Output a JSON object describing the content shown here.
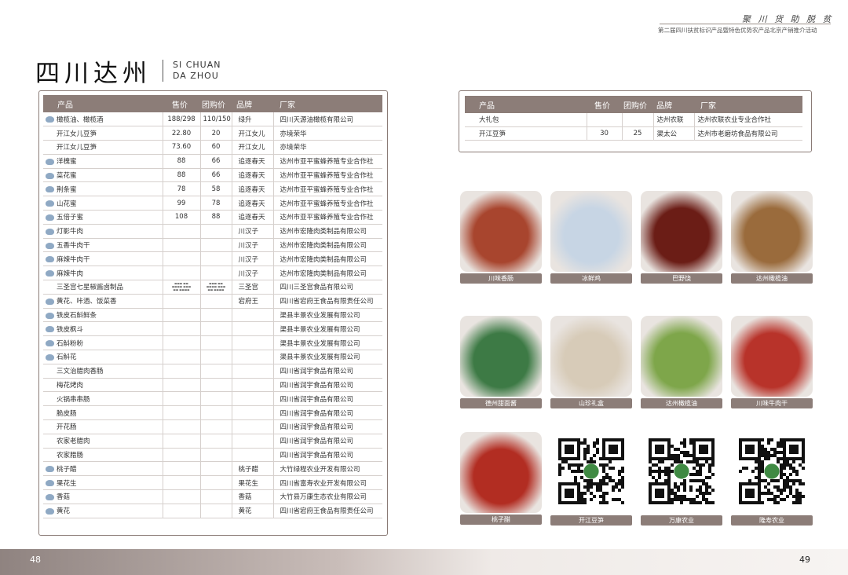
{
  "header": {
    "slogan": "聚 川 货   助 脱 贫",
    "subtitle": "第二届四川扶贫标识产品暨特色优势农产品北京产销推介活动"
  },
  "title": {
    "cn": "四川达州",
    "en1": "SI CHUAN",
    "en2": "DA ZHOU"
  },
  "left_table": {
    "headers": [
      "产品",
      "售价",
      "团购价",
      "品牌",
      "厂家"
    ],
    "rows": [
      {
        "icon": true,
        "product": "橄榄油、橄榄酒",
        "price": "188/298",
        "group": "110/150",
        "brand": "绿升",
        "maker": "四川天源油橄榄有限公司"
      },
      {
        "icon": false,
        "product": "开江女儿豆笋",
        "price": "22.80",
        "group": "20",
        "brand": "开江女儿",
        "maker": "亦境荣华"
      },
      {
        "icon": false,
        "product": "开江女儿豆笋",
        "price": "73.60",
        "group": "60",
        "brand": "开江女儿",
        "maker": "亦境荣华"
      },
      {
        "icon": true,
        "product": "洋槐蜜",
        "price": "88",
        "group": "66",
        "brand": "追逐春天",
        "maker": "达州市亚平蜜蜂养殖专业合作社"
      },
      {
        "icon": true,
        "product": "菜花蜜",
        "price": "88",
        "group": "66",
        "brand": "追逐春天",
        "maker": "达州市亚平蜜蜂养殖专业合作社"
      },
      {
        "icon": true,
        "product": "荆条蜜",
        "price": "78",
        "group": "58",
        "brand": "追逐春天",
        "maker": "达州市亚平蜜蜂养殖专业合作社"
      },
      {
        "icon": true,
        "product": "山花蜜",
        "price": "99",
        "group": "78",
        "brand": "追逐春天",
        "maker": "达州市亚平蜜蜂养殖专业合作社"
      },
      {
        "icon": true,
        "product": "五倍子蜜",
        "price": "108",
        "group": "88",
        "brand": "追逐春天",
        "maker": "达州市亚平蜜蜂养殖专业合作社"
      },
      {
        "icon": true,
        "product": "灯影牛肉",
        "price": "",
        "group": "",
        "brand": "川汉子",
        "maker": "达州市宏隆肉类制品有限公司"
      },
      {
        "icon": true,
        "product": "五香牛肉干",
        "price": "",
        "group": "",
        "brand": "川汉子",
        "maker": "达州市宏隆肉类制品有限公司"
      },
      {
        "icon": true,
        "product": "麻辣牛肉干",
        "price": "",
        "group": "",
        "brand": "川汉子",
        "maker": "达州市宏隆肉类制品有限公司"
      },
      {
        "icon": true,
        "product": "麻辣牛肉",
        "price": "",
        "group": "",
        "brand": "川汉子",
        "maker": "达州市宏隆肉类制品有限公司"
      },
      {
        "icon": false,
        "product": "三圣宫七星椒酱卤制品",
        "price": "",
        "group": "",
        "brand": "三圣宫",
        "maker": "四川三圣宫食品有限公司",
        "tiny": true
      },
      {
        "icon": true,
        "product": "黄花、咔酒、饭菜香",
        "price": "",
        "group": "",
        "brand": "宕府王",
        "maker": "四川省宕府王食品有限责任公司"
      },
      {
        "icon": true,
        "product": "铁皮石斛鲜条",
        "price": "",
        "group": "",
        "brand": "",
        "maker": "渠县丰景农业发展有限公司"
      },
      {
        "icon": true,
        "product": "铁皮枫斗",
        "price": "",
        "group": "",
        "brand": "",
        "maker": "渠县丰景农业发展有限公司"
      },
      {
        "icon": true,
        "product": "石斛粉粉",
        "price": "",
        "group": "",
        "brand": "",
        "maker": "渠县丰景农业发展有限公司"
      },
      {
        "icon": true,
        "product": "石斛花",
        "price": "",
        "group": "",
        "brand": "",
        "maker": "渠县丰景农业发展有限公司"
      },
      {
        "icon": false,
        "product": "三文治腊肉香肠",
        "price": "",
        "group": "",
        "brand": "",
        "maker": "四川省润宇食品有限公司"
      },
      {
        "icon": false,
        "product": "梅花烤肉",
        "price": "",
        "group": "",
        "brand": "",
        "maker": "四川省润宇食品有限公司"
      },
      {
        "icon": false,
        "product": "火锅串串肠",
        "price": "",
        "group": "",
        "brand": "",
        "maker": "四川省润宇食品有限公司"
      },
      {
        "icon": false,
        "product": "脆皮肠",
        "price": "",
        "group": "",
        "brand": "",
        "maker": "四川省润宇食品有限公司"
      },
      {
        "icon": false,
        "product": "开花肠",
        "price": "",
        "group": "",
        "brand": "",
        "maker": "四川省润宇食品有限公司"
      },
      {
        "icon": false,
        "product": "农家老腊肉",
        "price": "",
        "group": "",
        "brand": "",
        "maker": "四川省润宇食品有限公司"
      },
      {
        "icon": false,
        "product": "农家腊肠",
        "price": "",
        "group": "",
        "brand": "",
        "maker": "四川省润宇食品有限公司"
      },
      {
        "icon": true,
        "product": "桃子醋",
        "price": "",
        "group": "",
        "brand": "桃子醋",
        "maker": "大竹绿程农业开发有限公司"
      },
      {
        "icon": true,
        "product": "果花生",
        "price": "",
        "group": "",
        "brand": "果花生",
        "maker": "四川省富寿农业开发有限公司"
      },
      {
        "icon": true,
        "product": "香菇",
        "price": "",
        "group": "",
        "brand": "香菇",
        "maker": "大竹县万康生态农业有限公司"
      },
      {
        "icon": true,
        "product": "黄花",
        "price": "",
        "group": "",
        "brand": "黄花",
        "maker": "四川省宕府王食品有限责任公司"
      }
    ]
  },
  "right_table": {
    "headers": [
      "产品",
      "售价",
      "团购价",
      "品牌",
      "厂家"
    ],
    "rows": [
      {
        "product": "大礼包",
        "price": "",
        "group": "",
        "brand": "达州农联",
        "maker": "达州农联农业专业合作社"
      },
      {
        "product": "开江豆笋",
        "price": "30",
        "group": "25",
        "brand": "渠太公",
        "maker": "达州市老磨坊食品有限公司"
      }
    ]
  },
  "products": [
    {
      "caption": "川味香肠",
      "color": "#a8452e"
    },
    {
      "caption": "冰鲜鸡",
      "color": "#c7d5e4"
    },
    {
      "caption": "巴野饶",
      "color": "#6b1d16"
    },
    {
      "caption": "达州橄榄油",
      "color": "#9a6b3c"
    },
    {
      "caption": "德州甜面酱",
      "color": "#3d7a45"
    },
    {
      "caption": "山珍礼盒",
      "color": "#d7cbb8"
    },
    {
      "caption": "达州橄榄油",
      "color": "#7ea64a"
    },
    {
      "caption": "川味牛肉干",
      "color": "#b8332a"
    },
    {
      "caption": "桃子醋",
      "color": "#b22d22"
    }
  ],
  "qr_captions": [
    "开江豆笋",
    "万康农业",
    "隆寿农业"
  ],
  "footer": {
    "left_page": "48",
    "right_page": "49"
  }
}
